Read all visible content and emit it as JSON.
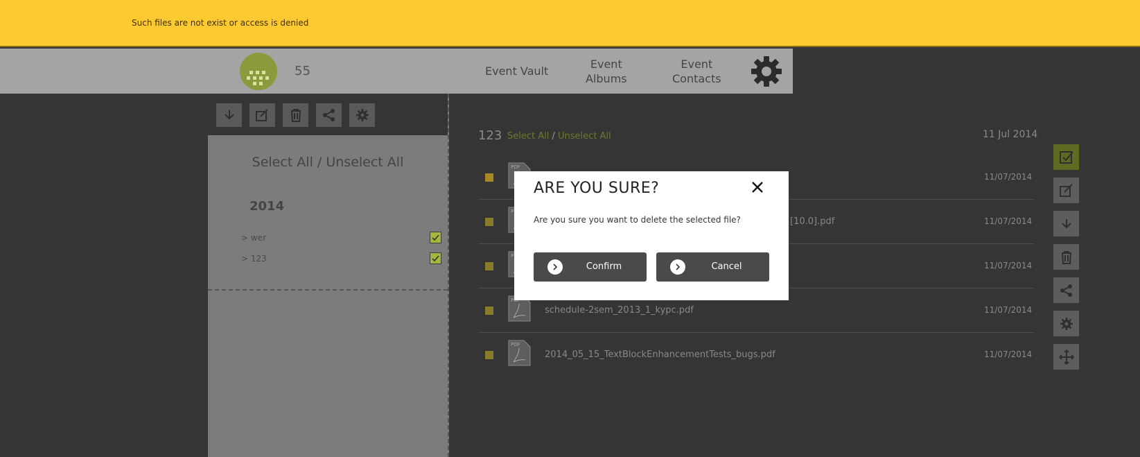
{
  "notification": {
    "text": "Such files are not exist or access is denied"
  },
  "header": {
    "count": "55",
    "nav": [
      {
        "label": "Event Vault"
      },
      {
        "label": "Event\nAlbums"
      },
      {
        "label": "Event\nContacts"
      }
    ]
  },
  "left_panel": {
    "toolbar_icons": [
      "download-icon",
      "edit-icon",
      "trash-icon",
      "share-icon",
      "gear-icon"
    ],
    "select_all_label": "Select All / Unselect All",
    "year": "2014",
    "folders": [
      {
        "label": "> wer",
        "checked": true
      },
      {
        "label": "> 123",
        "checked": true
      }
    ]
  },
  "list": {
    "folder_name": "123",
    "select_all": "Select All",
    "slash": "/",
    "unselect_all": "Unselect All",
    "date": "11 Jul 2014",
    "files": [
      {
        "name": "",
        "date": "11/07/2014"
      },
      {
        "name": "[10.0].pdf",
        "date": "11/07/2014"
      },
      {
        "name": "",
        "date": "11/07/2014"
      },
      {
        "name": "schedule-2sem_2013_1_kypc.pdf",
        "date": "11/07/2014"
      },
      {
        "name": "2014_05_15_TextBlockEnhancementTests_bugs.pdf",
        "date": "11/07/2014"
      }
    ]
  },
  "right_toolbar": {
    "icons": [
      "check-icon",
      "edit-icon",
      "download-icon",
      "trash-icon",
      "share-icon",
      "gear-icon",
      "move-icon"
    ]
  },
  "dialog": {
    "title": "ARE YOU SURE?",
    "message": "Are you sure you want to delete the selected file?",
    "confirm_label": "Confirm",
    "cancel_label": "Cancel"
  },
  "colors": {
    "notification": "#ffc931",
    "accent": "#8a9a3c",
    "background": "#353535"
  }
}
